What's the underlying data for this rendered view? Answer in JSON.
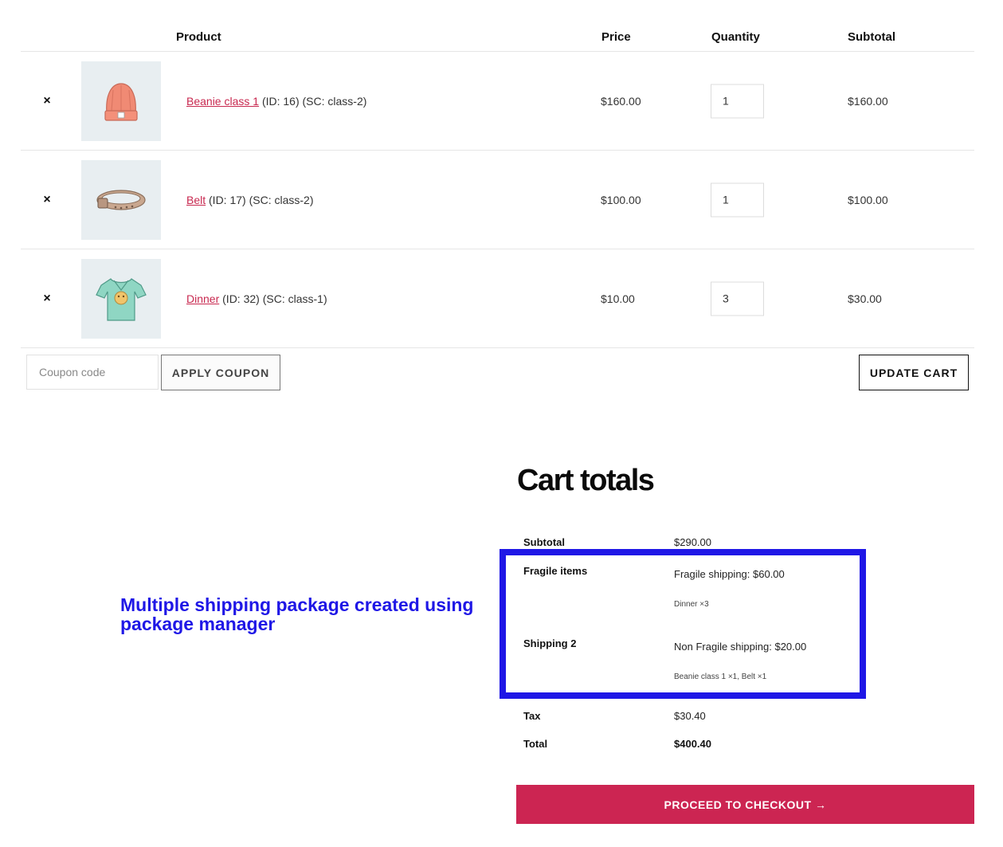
{
  "table": {
    "headers": {
      "product": "Product",
      "price": "Price",
      "quantity": "Quantity",
      "subtotal": "Subtotal"
    },
    "rows": [
      {
        "remove": "×",
        "product_link": "Beanie class 1",
        "product_meta": " (ID: 16) (SC: class-2)",
        "price": "$160.00",
        "quantity": "1",
        "subtotal": "$160.00",
        "image_icon": "beanie-icon"
      },
      {
        "remove": "×",
        "product_link": "Belt",
        "product_meta": " (ID: 17) (SC: class-2)",
        "price": "$100.00",
        "quantity": "1",
        "subtotal": "$100.00",
        "image_icon": "belt-icon"
      },
      {
        "remove": "×",
        "product_link": "Dinner",
        "product_meta": " (ID: 32) (SC: class-1)",
        "price": "$10.00",
        "quantity": "3",
        "subtotal": "$30.00",
        "image_icon": "tshirt-icon"
      }
    ]
  },
  "coupon": {
    "placeholder": "Coupon code",
    "apply_label": "APPLY COUPON"
  },
  "update_label": "UPDATE CART",
  "annotation": "Multiple shipping package created using package manager",
  "totals": {
    "title": "Cart totals",
    "subtotal_label": "Subtotal",
    "subtotal_value": "$290.00",
    "packages": [
      {
        "label": "Fragile items",
        "method": "Fragile shipping: $60.00",
        "items": "Dinner ×3"
      },
      {
        "label": "Shipping 2",
        "method": "Non Fragile shipping: $20.00",
        "items": "Beanie class 1 ×1, Belt ×1"
      }
    ],
    "tax_label": "Tax",
    "tax_value": "$30.40",
    "total_label": "Total",
    "total_value": "$400.40"
  },
  "checkout_label": "PROCEED TO CHECKOUT →",
  "colors": {
    "accent": "#cc2552",
    "link": "#c8284f",
    "annotation": "#1f17e6",
    "thumb_bg": "#e8eef1"
  }
}
